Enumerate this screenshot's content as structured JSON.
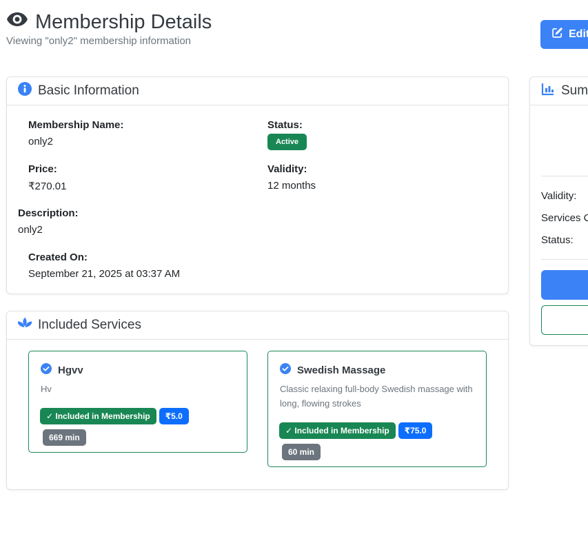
{
  "header": {
    "title": "Membership Details",
    "subtitle": "Viewing \"only2\" membership information",
    "edit_label": "Edit"
  },
  "basic": {
    "heading": "Basic Information",
    "name_label": "Membership Name:",
    "name_value": "only2",
    "status_label": "Status:",
    "status_value": "Active",
    "price_label": "Price:",
    "price_value": "₹270.01",
    "validity_label": "Validity:",
    "validity_value": "12 months",
    "description_label": "Description:",
    "description_value": "only2",
    "created_label": "Created On:",
    "created_value": "September 21, 2025 at 03:37 AM"
  },
  "services": {
    "heading": "Included Services",
    "items": [
      {
        "name": "Hgvv",
        "description": "Hv",
        "included_label": "✓ Included in Membership",
        "price": "₹5.0",
        "duration": "669 min"
      },
      {
        "name": "Swedish Massage",
        "description": "Classic relaxing full-body Swedish massage with long, flowing strokes",
        "included_label": "✓ Included in Membership",
        "price": "₹75.0",
        "duration": "60 min"
      }
    ]
  },
  "summary": {
    "heading": "Summary",
    "validity_label": "Validity:",
    "services_label": "Services C",
    "status_label": "Status:"
  },
  "colors": {
    "primary": "#3b82f6",
    "success": "#198754",
    "badge_blue": "#0d6efd",
    "secondary": "#6c757d"
  },
  "icons": {
    "title": "eye-icon",
    "edit": "edit-icon",
    "basic": "info-circle-icon",
    "services": "spa-lotus-icon",
    "service_check": "check-circle-icon",
    "summary": "bar-chart-icon"
  }
}
